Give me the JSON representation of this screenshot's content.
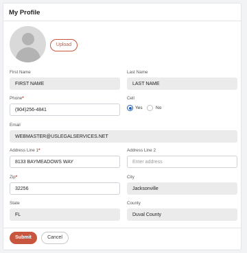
{
  "header": {
    "title": "My Profile"
  },
  "avatar": {
    "upload_label": "Upload"
  },
  "form": {
    "first_name": {
      "label": "First Name",
      "value": "FIRST NAME"
    },
    "last_name": {
      "label": "Last Name",
      "value": "LAST NAME"
    },
    "phone": {
      "label": "Phone",
      "value": "(904)256-4841",
      "required_mark": "*"
    },
    "phone_type": {
      "label": "Cell",
      "options": [
        "Yes",
        "No"
      ],
      "selected": "Yes"
    },
    "email": {
      "label": "Email",
      "value": "WEBMASTER@USLEGALSERVICES.NET"
    },
    "address1": {
      "label": "Address Line 1",
      "value": "8133 BAYMEADOWS WAY",
      "required_mark": "*"
    },
    "address2": {
      "label": "Address Line 2",
      "placeholder": "Enter address"
    },
    "zip": {
      "label": "Zip",
      "value": "32256",
      "required_mark": "*"
    },
    "city": {
      "label": "City",
      "value": "Jacksonville"
    },
    "state": {
      "label": "State",
      "value": "FL"
    },
    "county": {
      "label": "County",
      "value": "Duval County"
    }
  },
  "actions": {
    "submit_label": "Submit",
    "cancel_label": "Cancel"
  },
  "colors": {
    "accent": "#c8553d",
    "radio": "#1f5fbf",
    "required": "#d0312d"
  }
}
